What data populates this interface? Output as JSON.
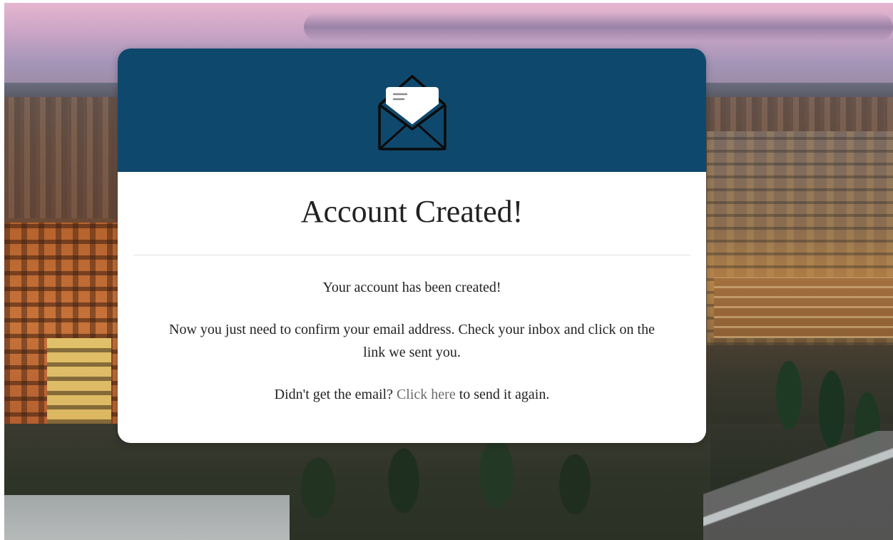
{
  "card": {
    "title": "Account Created!",
    "message_created": "Your account has been created!",
    "message_confirm": "Now you just need to confirm your email address. Check your inbox and click on the link we sent you.",
    "resend_prefix": "Didn't get the email?",
    "resend_link": "Click here",
    "resend_suffix": "to send it again."
  },
  "icons": {
    "header_icon": "open-envelope-icon"
  },
  "colors": {
    "header_background": "#0f486d",
    "card_background": "#ffffff",
    "link": "#6b6b6b",
    "text": "#222222"
  }
}
